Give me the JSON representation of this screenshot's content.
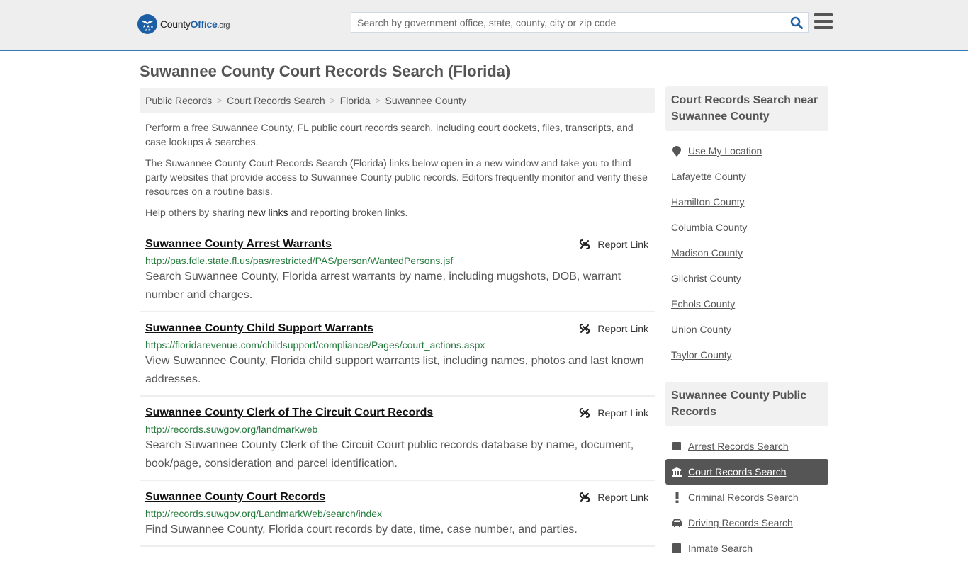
{
  "header": {
    "logo": {
      "county": "County",
      "office": "Office",
      "org": ".org"
    },
    "search_placeholder": "Search by government office, state, county, city or zip code",
    "search_icon": "search-icon",
    "menu_icon": "hamburger-menu-icon"
  },
  "page": {
    "title": "Suwannee County Court Records Search (Florida)"
  },
  "breadcrumb": [
    {
      "label": "Public Records"
    },
    {
      "label": "Court Records Search"
    },
    {
      "label": "Florida"
    },
    {
      "label": "Suwannee County"
    }
  ],
  "intro": {
    "p1": "Perform a free Suwannee County, FL public court records search, including court dockets, files, transcripts, and case lookups & searches.",
    "p2": "The Suwannee County Court Records Search (Florida) links below open in a new window and take you to third party websites that provide access to Suwannee County public records. Editors frequently monitor and verify these resources on a routine basis.",
    "p3_before": "Help others by sharing ",
    "p3_link": "new links",
    "p3_after": " and reporting broken links."
  },
  "results": [
    {
      "title": "Suwannee County Arrest Warrants",
      "url": "http://pas.fdle.state.fl.us/pas/restricted/PAS/person/WantedPersons.jsf",
      "description": "Search Suwannee County, Florida arrest warrants by name, including mugshots, DOB, warrant number and charges.",
      "report_label": "Report Link"
    },
    {
      "title": "Suwannee County Child Support Warrants",
      "url": "https://floridarevenue.com/childsupport/compliance/Pages/court_actions.aspx",
      "description": "View Suwannee County, Florida child support warrants list, including names, photos and last known addresses.",
      "report_label": "Report Link"
    },
    {
      "title": "Suwannee County Clerk of The Circuit Court Records",
      "url": "http://records.suwgov.org/landmarkweb",
      "description": "Search Suwannee County Clerk of the Circuit Court public records database by name, document, book/page, consideration and parcel identification.",
      "report_label": "Report Link"
    },
    {
      "title": "Suwannee County Court Records",
      "url": "http://records.suwgov.org/LandmarkWeb/search/index",
      "description": "Find Suwannee County, Florida court records by date, time, case number, and parties.",
      "report_label": "Report Link"
    }
  ],
  "sidebar": {
    "nearby_heading": "Court Records Search near Suwannee County",
    "use_location": "Use My Location",
    "nearby": [
      "Lafayette County",
      "Hamilton County",
      "Columbia County",
      "Madison County",
      "Gilchrist County",
      "Echols County",
      "Union County",
      "Taylor County"
    ],
    "public_heading": "Suwannee County Public Records",
    "public_records": [
      {
        "label": "Arrest Records Search",
        "icon": "square-icon",
        "active": false
      },
      {
        "label": "Court Records Search",
        "icon": "courthouse-icon",
        "active": true
      },
      {
        "label": "Criminal Records Search",
        "icon": "exclamation-icon",
        "active": false
      },
      {
        "label": "Driving Records Search",
        "icon": "car-icon",
        "active": false
      },
      {
        "label": "Inmate Search",
        "icon": "inmate-icon",
        "active": false
      }
    ]
  },
  "colors": {
    "accent": "#337ab7",
    "logo_blue": "#1d5fa6",
    "url_green": "#237a3b",
    "active_bg": "#555555"
  }
}
